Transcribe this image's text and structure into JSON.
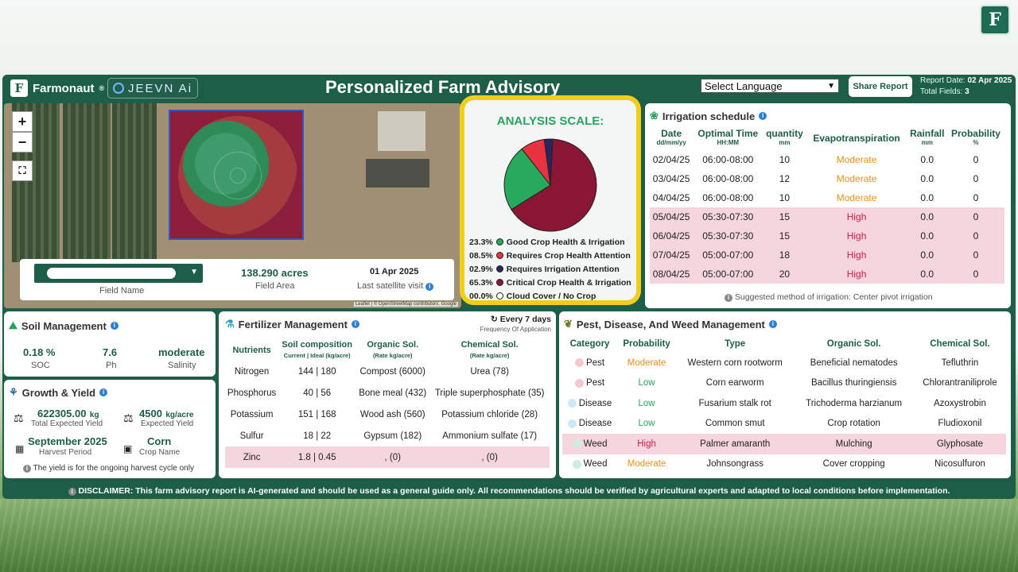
{
  "header": {
    "brand": "Farmonaut",
    "brand_mark": "®",
    "partner": "JEEVN Ai",
    "title": "Personalized Farm Advisory",
    "language_placeholder": "Select Language",
    "share_label": "Share Report",
    "report_date_label": "Report Date:",
    "report_date": "02 Apr 2025",
    "total_fields_label": "Total Fields:",
    "total_fields": "3"
  },
  "map": {
    "zoom_in": "+",
    "zoom_out": "−",
    "attribution": "Leaflet | © OpenStreetMap contributors, Google",
    "field_name_label": "Field Name",
    "field_area": "138.290 acres",
    "field_area_label": "Field Area",
    "last_visit_date": "01 Apr 2025",
    "last_visit_label": "Last satellite visit"
  },
  "analysis": {
    "title": "ANALYSIS SCALE:",
    "legend": [
      {
        "pct": "23.3%",
        "label": "Good Crop Health & Irrigation",
        "color": "#27a95e"
      },
      {
        "pct": "08.5%",
        "label": "Requires Crop Health Attention",
        "color": "#e8323f"
      },
      {
        "pct": "02.9%",
        "label": "Requires Irrigation Attention",
        "color": "#2b2460"
      },
      {
        "pct": "65.3%",
        "label": "Critical Crop Health & Irrigation",
        "color": "#8b1535"
      },
      {
        "pct": "00.0%",
        "label": "Cloud Cover / No Crop",
        "color": "#ffffff"
      }
    ],
    "slices": [
      65.3,
      23.3,
      8.5,
      2.9
    ]
  },
  "irrigation": {
    "title": "Irrigation schedule",
    "headers": {
      "date": "Date",
      "date_unit": "dd/mm/yy",
      "time": "Optimal Time",
      "time_unit": "HH:MM",
      "qty": "quantity",
      "qty_unit": "mm",
      "evap": "Evapotranspiration",
      "rain": "Rainfall",
      "rain_unit": "mm",
      "prob": "Probability",
      "prob_unit": "%"
    },
    "rows": [
      {
        "date": "02/04/25",
        "time": "06:00-08:00",
        "qty": "10",
        "evap": "Moderate",
        "rain": "0.0",
        "prob": "0"
      },
      {
        "date": "03/04/25",
        "time": "06:00-08:00",
        "qty": "12",
        "evap": "Moderate",
        "rain": "0.0",
        "prob": "0"
      },
      {
        "date": "04/04/25",
        "time": "06:00-08:00",
        "qty": "10",
        "evap": "Moderate",
        "rain": "0.0",
        "prob": "0"
      },
      {
        "date": "05/04/25",
        "time": "05:30-07:30",
        "qty": "15",
        "evap": "High",
        "rain": "0.0",
        "prob": "0"
      },
      {
        "date": "06/04/25",
        "time": "05:30-07:30",
        "qty": "15",
        "evap": "High",
        "rain": "0.0",
        "prob": "0"
      },
      {
        "date": "07/04/25",
        "time": "05:00-07:00",
        "qty": "18",
        "evap": "High",
        "rain": "0.0",
        "prob": "0"
      },
      {
        "date": "08/04/25",
        "time": "05:00-07:00",
        "qty": "20",
        "evap": "High",
        "rain": "0.0",
        "prob": "0"
      }
    ],
    "footnote": "Suggested method of irrigation: Center pivot irrigation"
  },
  "soil": {
    "title": "Soil Management",
    "soc": "0.18 %",
    "soc_label": "SOC",
    "ph": "7.6",
    "ph_label": "Ph",
    "salinity": "moderate",
    "salinity_label": "Salinity"
  },
  "growth": {
    "title": "Growth & Yield",
    "total_yield": "622305.00",
    "total_yield_unit": "kg",
    "total_yield_label": "Total Expected Yield",
    "yield_rate": "4500",
    "yield_rate_unit": "kg/acre",
    "yield_rate_label": "Expected Yield",
    "harvest": "September 2025",
    "harvest_label": "Harvest Period",
    "crop": "Corn",
    "crop_label": "Crop Name",
    "note": "The yield is for the ongoing harvest cycle only"
  },
  "fertilizer": {
    "title": "Fertilizer Management",
    "frequency": "Every 7 days",
    "frequency_label": "Frequency Of Application",
    "headers": {
      "nutrients": "Nutrients",
      "soil": "Soil composition",
      "soil_sub": "Current | Ideal (kg/acre)",
      "organic": "Organic Sol.",
      "organic_sub": "(Rate kg/acre)",
      "chemical": "Chemical Sol.",
      "chemical_sub": "(Rate kg/acre)"
    },
    "rows": [
      {
        "nutrient": "Nitrogen",
        "soil": "144 | 180",
        "organic": "Compost (6000)",
        "chemical": "Urea (78)"
      },
      {
        "nutrient": "Phosphorus",
        "soil": "40 | 56",
        "organic": "Bone meal (432)",
        "chemical": "Triple superphosphate (35)"
      },
      {
        "nutrient": "Potassium",
        "soil": "151 | 168",
        "organic": "Wood ash (560)",
        "chemical": "Potassium chloride (28)"
      },
      {
        "nutrient": "Sulfur",
        "soil": "18 | 22",
        "organic": "Gypsum (182)",
        "chemical": "Ammonium sulfate (17)"
      },
      {
        "nutrient": "Zinc",
        "soil": "1.8 | 0.45",
        "organic": ", (0)",
        "chemical": ", (0)"
      }
    ]
  },
  "pest": {
    "title": "Pest, Disease, And Weed Management",
    "headers": {
      "category": "Category",
      "prob": "Probability",
      "type": "Type",
      "organic": "Organic Sol.",
      "chemical": "Chemical Sol."
    },
    "rows": [
      {
        "category": "Pest",
        "prob": "Moderate",
        "type": "Western corn rootworm",
        "organic": "Beneficial nematodes",
        "chemical": "Tefluthrin"
      },
      {
        "category": "Pest",
        "prob": "Low",
        "type": "Corn earworm",
        "organic": "Bacillus thuringiensis",
        "chemical": "Chlorantraniliprole"
      },
      {
        "category": "Disease",
        "prob": "Low",
        "type": "Fusarium stalk rot",
        "organic": "Trichoderma harzianum",
        "chemical": "Azoxystrobin"
      },
      {
        "category": "Disease",
        "prob": "Low",
        "type": "Common smut",
        "organic": "Crop rotation",
        "chemical": "Fludioxonil"
      },
      {
        "category": "Weed",
        "prob": "High",
        "type": "Palmer amaranth",
        "organic": "Mulching",
        "chemical": "Glyphosate"
      },
      {
        "category": "Weed",
        "prob": "Moderate",
        "type": "Johnsongrass",
        "organic": "Cover cropping",
        "chemical": "Nicosulfuron"
      }
    ]
  },
  "disclaimer": "DISCLAIMER: This farm advisory report is AI-generated and should be used as a general guide only. All recommendations should be verified by agricultural experts and adapted to local conditions before implementation."
}
